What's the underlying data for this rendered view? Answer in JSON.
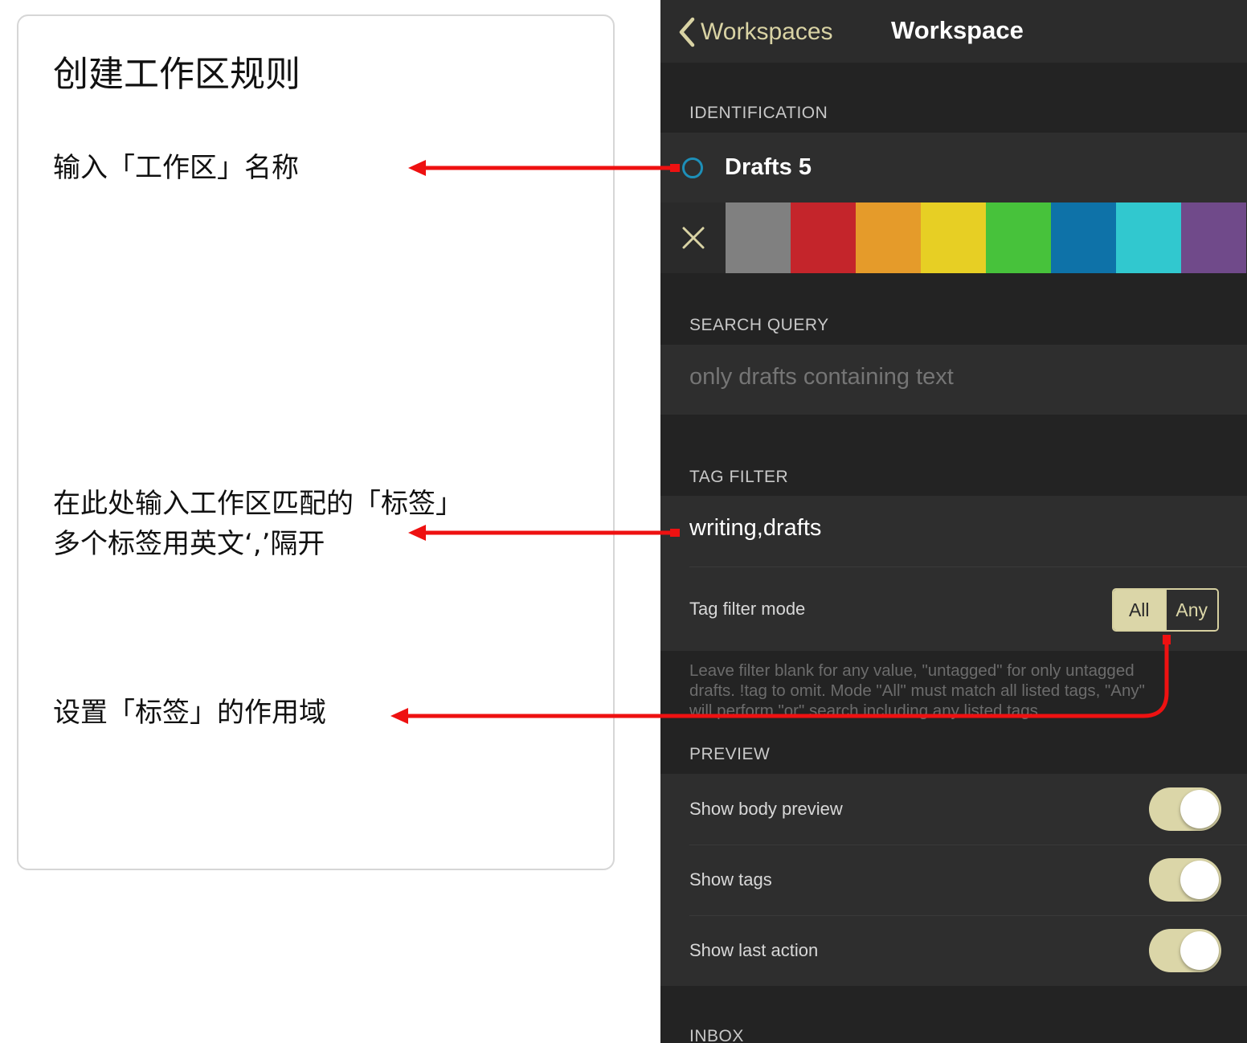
{
  "annotation": {
    "title": "创建工作区规则",
    "note_name": "输入「工作区」名称",
    "note_tags_line1": "在此处输入工作区匹配的「标签」",
    "note_tags_line2": "多个标签用英文‘,’隔开",
    "note_mode": "设置「标签」的作用域",
    "arrow_color": "#ee1111"
  },
  "nav": {
    "back_label": "Workspaces",
    "title": "Workspace",
    "accent_color": "#d9d3a4"
  },
  "identification": {
    "header": "IDENTIFICATION",
    "name": "Drafts 5",
    "radio_icon": "radio-circle-icon",
    "clear_icon": "close-x-icon",
    "colors": [
      "#808080",
      "#c4252b",
      "#e59b2a",
      "#e7cf24",
      "#47c23b",
      "#0e72a8",
      "#31c8cf",
      "#704a8a"
    ]
  },
  "search_query": {
    "header": "SEARCH QUERY",
    "placeholder": "only drafts containing text"
  },
  "tag_filter": {
    "header": "TAG FILTER",
    "value": "writing,drafts",
    "mode_label": "Tag filter mode",
    "mode_options": [
      "All",
      "Any"
    ],
    "mode_selected": "All",
    "help_line1": "Leave filter blank for any value, \"untagged\" for only untagged",
    "help_line2": "drafts. !tag to omit. Mode \"All\" must match all listed tags, \"Any\"",
    "help_line3": "will perform \"or\" search including any listed tags."
  },
  "preview": {
    "header": "PREVIEW",
    "toggles": [
      {
        "label": "Show body preview",
        "on": true
      },
      {
        "label": "Show tags",
        "on": true
      },
      {
        "label": "Show last action",
        "on": true
      }
    ]
  },
  "inbox": {
    "header": "INBOX"
  }
}
